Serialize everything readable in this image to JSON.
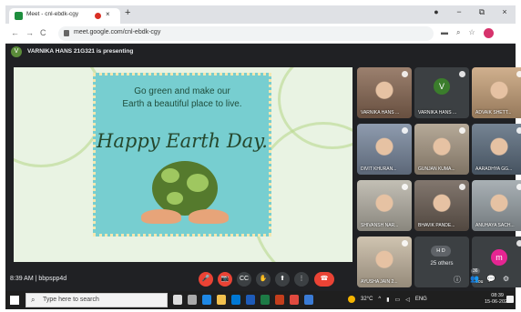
{
  "browser": {
    "tab_title": "Meet - cnl-ebdk-cgy",
    "tab_close": "×",
    "new_tab": "+",
    "window_controls": [
      "●",
      "−",
      "⧉",
      "×"
    ],
    "nav": [
      "←",
      "→",
      "C"
    ],
    "url": "meet.google.com/cnl-ebdk-cgy",
    "toolbar_icons": [
      "▬",
      "⌕",
      "☆"
    ],
    "profile_color": "#d6336c"
  },
  "meet": {
    "presenter_initial": "V",
    "presenter_text": "VARNIKA HANS 21G321 is presenting",
    "slide": {
      "line1": "Go green and make our",
      "line2": "Earth a beautiful place to live.",
      "headline": "Happy Earth Day."
    },
    "tiles": [
      {
        "name": "VARNIKA HANS ...",
        "type": "photo"
      },
      {
        "name": "VARNIKA HANS ...",
        "type": "avatar",
        "initial": "V"
      },
      {
        "name": "ADVAIK SHETT...",
        "type": "photo"
      },
      {
        "name": "DIVIT KHURAN...",
        "type": "photo"
      },
      {
        "name": "GUNJAN KUMA...",
        "type": "photo"
      },
      {
        "name": "AARADHYA GG...",
        "type": "photo"
      },
      {
        "name": "SHIVANSH NAR...",
        "type": "photo"
      },
      {
        "name": "BHAVIK PANDE...",
        "type": "photo"
      },
      {
        "name": "ANUHAYA SACH...",
        "type": "photo"
      },
      {
        "name": "AYUSHA JAIN 2...",
        "type": "photo"
      },
      {
        "name": "25 others",
        "type": "others",
        "initials": "H D"
      },
      {
        "name": "You",
        "type": "avatar",
        "initial": "m"
      }
    ],
    "time_code": "8:39 AM | bbpspp4d",
    "controls": [
      "🎤",
      "📷",
      "CC",
      "✋",
      "⬆",
      "⋮",
      "☎"
    ],
    "right_icons": [
      "ⓘ",
      "👥",
      "💬",
      "⚙"
    ],
    "participant_count": "36"
  },
  "taskbar": {
    "search_placeholder": "Type here to search",
    "weather": "32°C",
    "lang": "ENG",
    "time": "08:39",
    "date": "15-06-2021"
  }
}
